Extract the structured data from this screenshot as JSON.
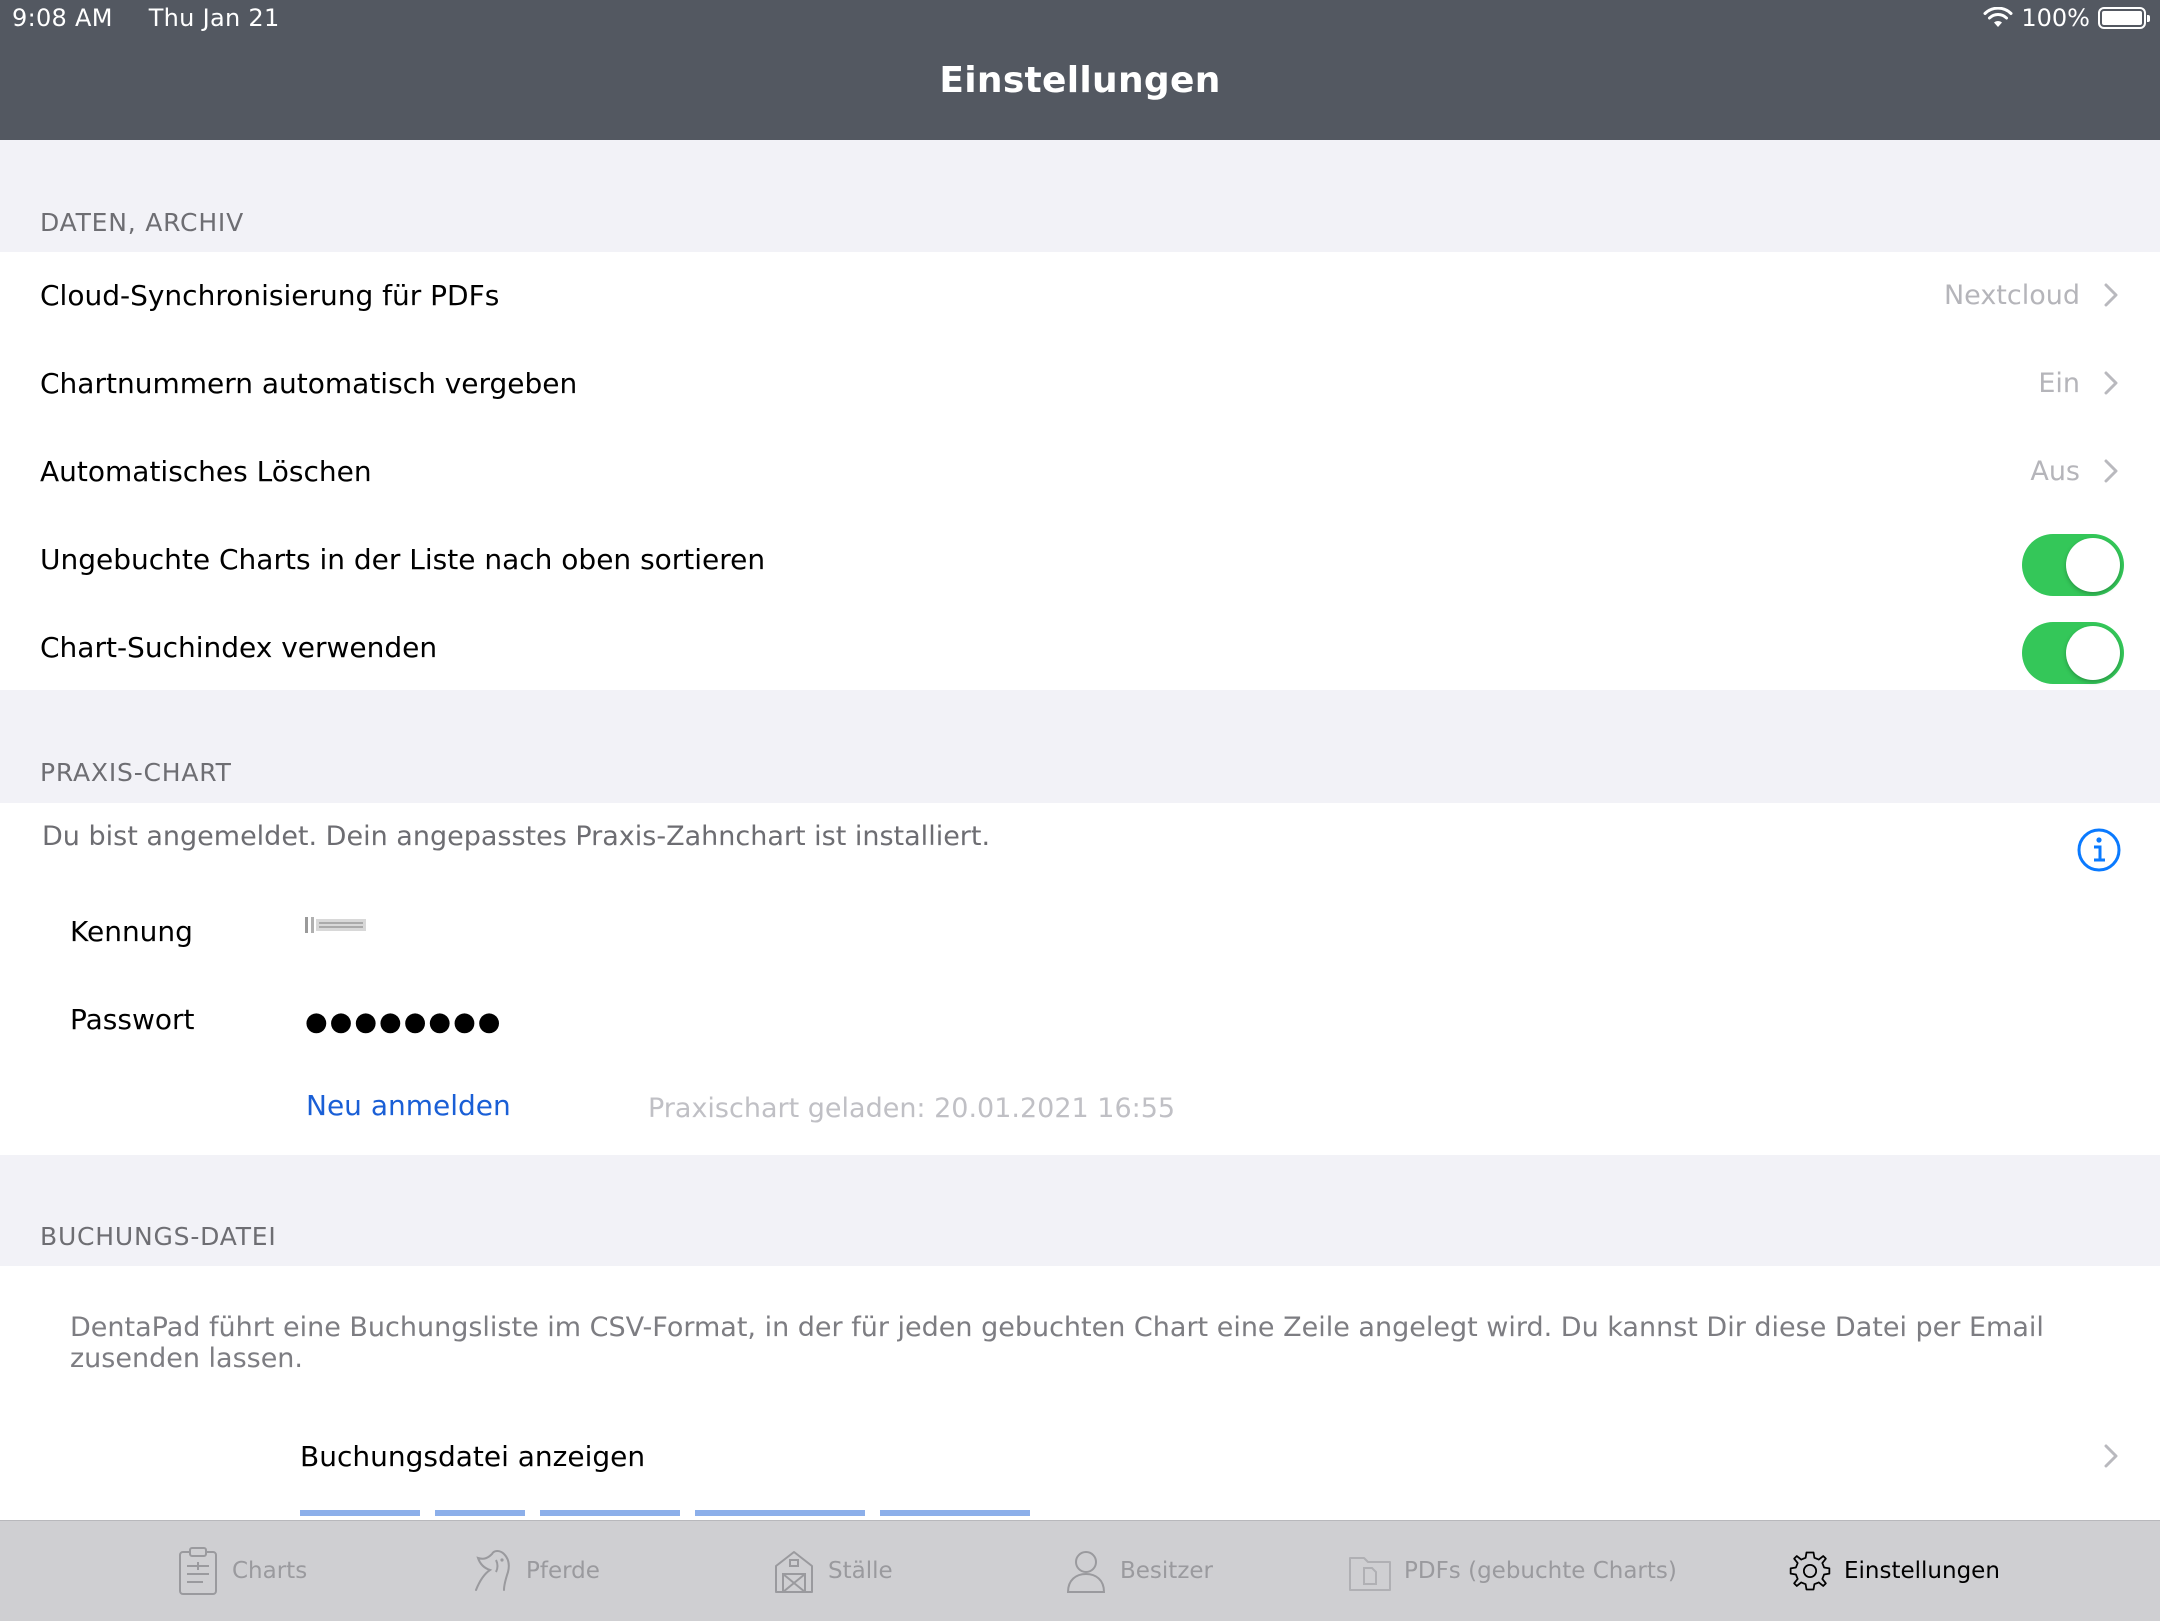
{
  "status_bar": {
    "time": "9:08 AM",
    "date": "Thu Jan 21",
    "battery": "100%"
  },
  "nav": {
    "title": "Einstellungen"
  },
  "sections": {
    "daten": {
      "header": "DATEN, ARCHIV",
      "rows": [
        {
          "label": "Cloud-Synchronisierung für PDFs",
          "value": "Nextcloud"
        },
        {
          "label": "Chartnummern automatisch vergeben",
          "value": "Ein"
        },
        {
          "label": "Automatisches Löschen",
          "value": "Aus"
        },
        {
          "label": "Ungebuchte Charts in der Liste nach oben sortieren",
          "toggle": true
        },
        {
          "label": "Chart-Suchindex verwenden",
          "toggle": true
        }
      ]
    },
    "praxis": {
      "header": "PRAXIS-CHART",
      "status": "Du bist angemeldet. Dein angepasstes Praxis-Zahnchart ist installiert.",
      "kennung_label": "Kennung",
      "passwort_label": "Passwort",
      "passwort_value": "●●●●●●●●",
      "relogin_link": "Neu anmelden",
      "loaded_info": "Praxischart geladen: 20.01.2021 16:55"
    },
    "buchung": {
      "header": "BUCHUNGS-DATEI",
      "description": "DentaPad führt eine Buchungsliste im CSV-Format, in der für jeden gebuchten Chart eine Zeile angelegt wird. Du kannst Dir diese Datei per Email zusenden lassen.",
      "show_file": "Buchungsdatei anzeigen"
    }
  },
  "tabs": [
    {
      "label": "Charts",
      "icon": "clipboard-icon"
    },
    {
      "label": "Pferde",
      "icon": "horse-icon"
    },
    {
      "label": "Ställe",
      "icon": "barn-icon"
    },
    {
      "label": "Besitzer",
      "icon": "person-icon"
    },
    {
      "label": "PDFs (gebuchte Charts)",
      "icon": "folder-icon"
    },
    {
      "label": "Einstellungen",
      "icon": "gear-icon",
      "active": true
    }
  ],
  "colors": {
    "nav_bg": "#535861",
    "toggle_on": "#34c759",
    "link": "#1a5fd6",
    "tint": "#0a7aff"
  }
}
